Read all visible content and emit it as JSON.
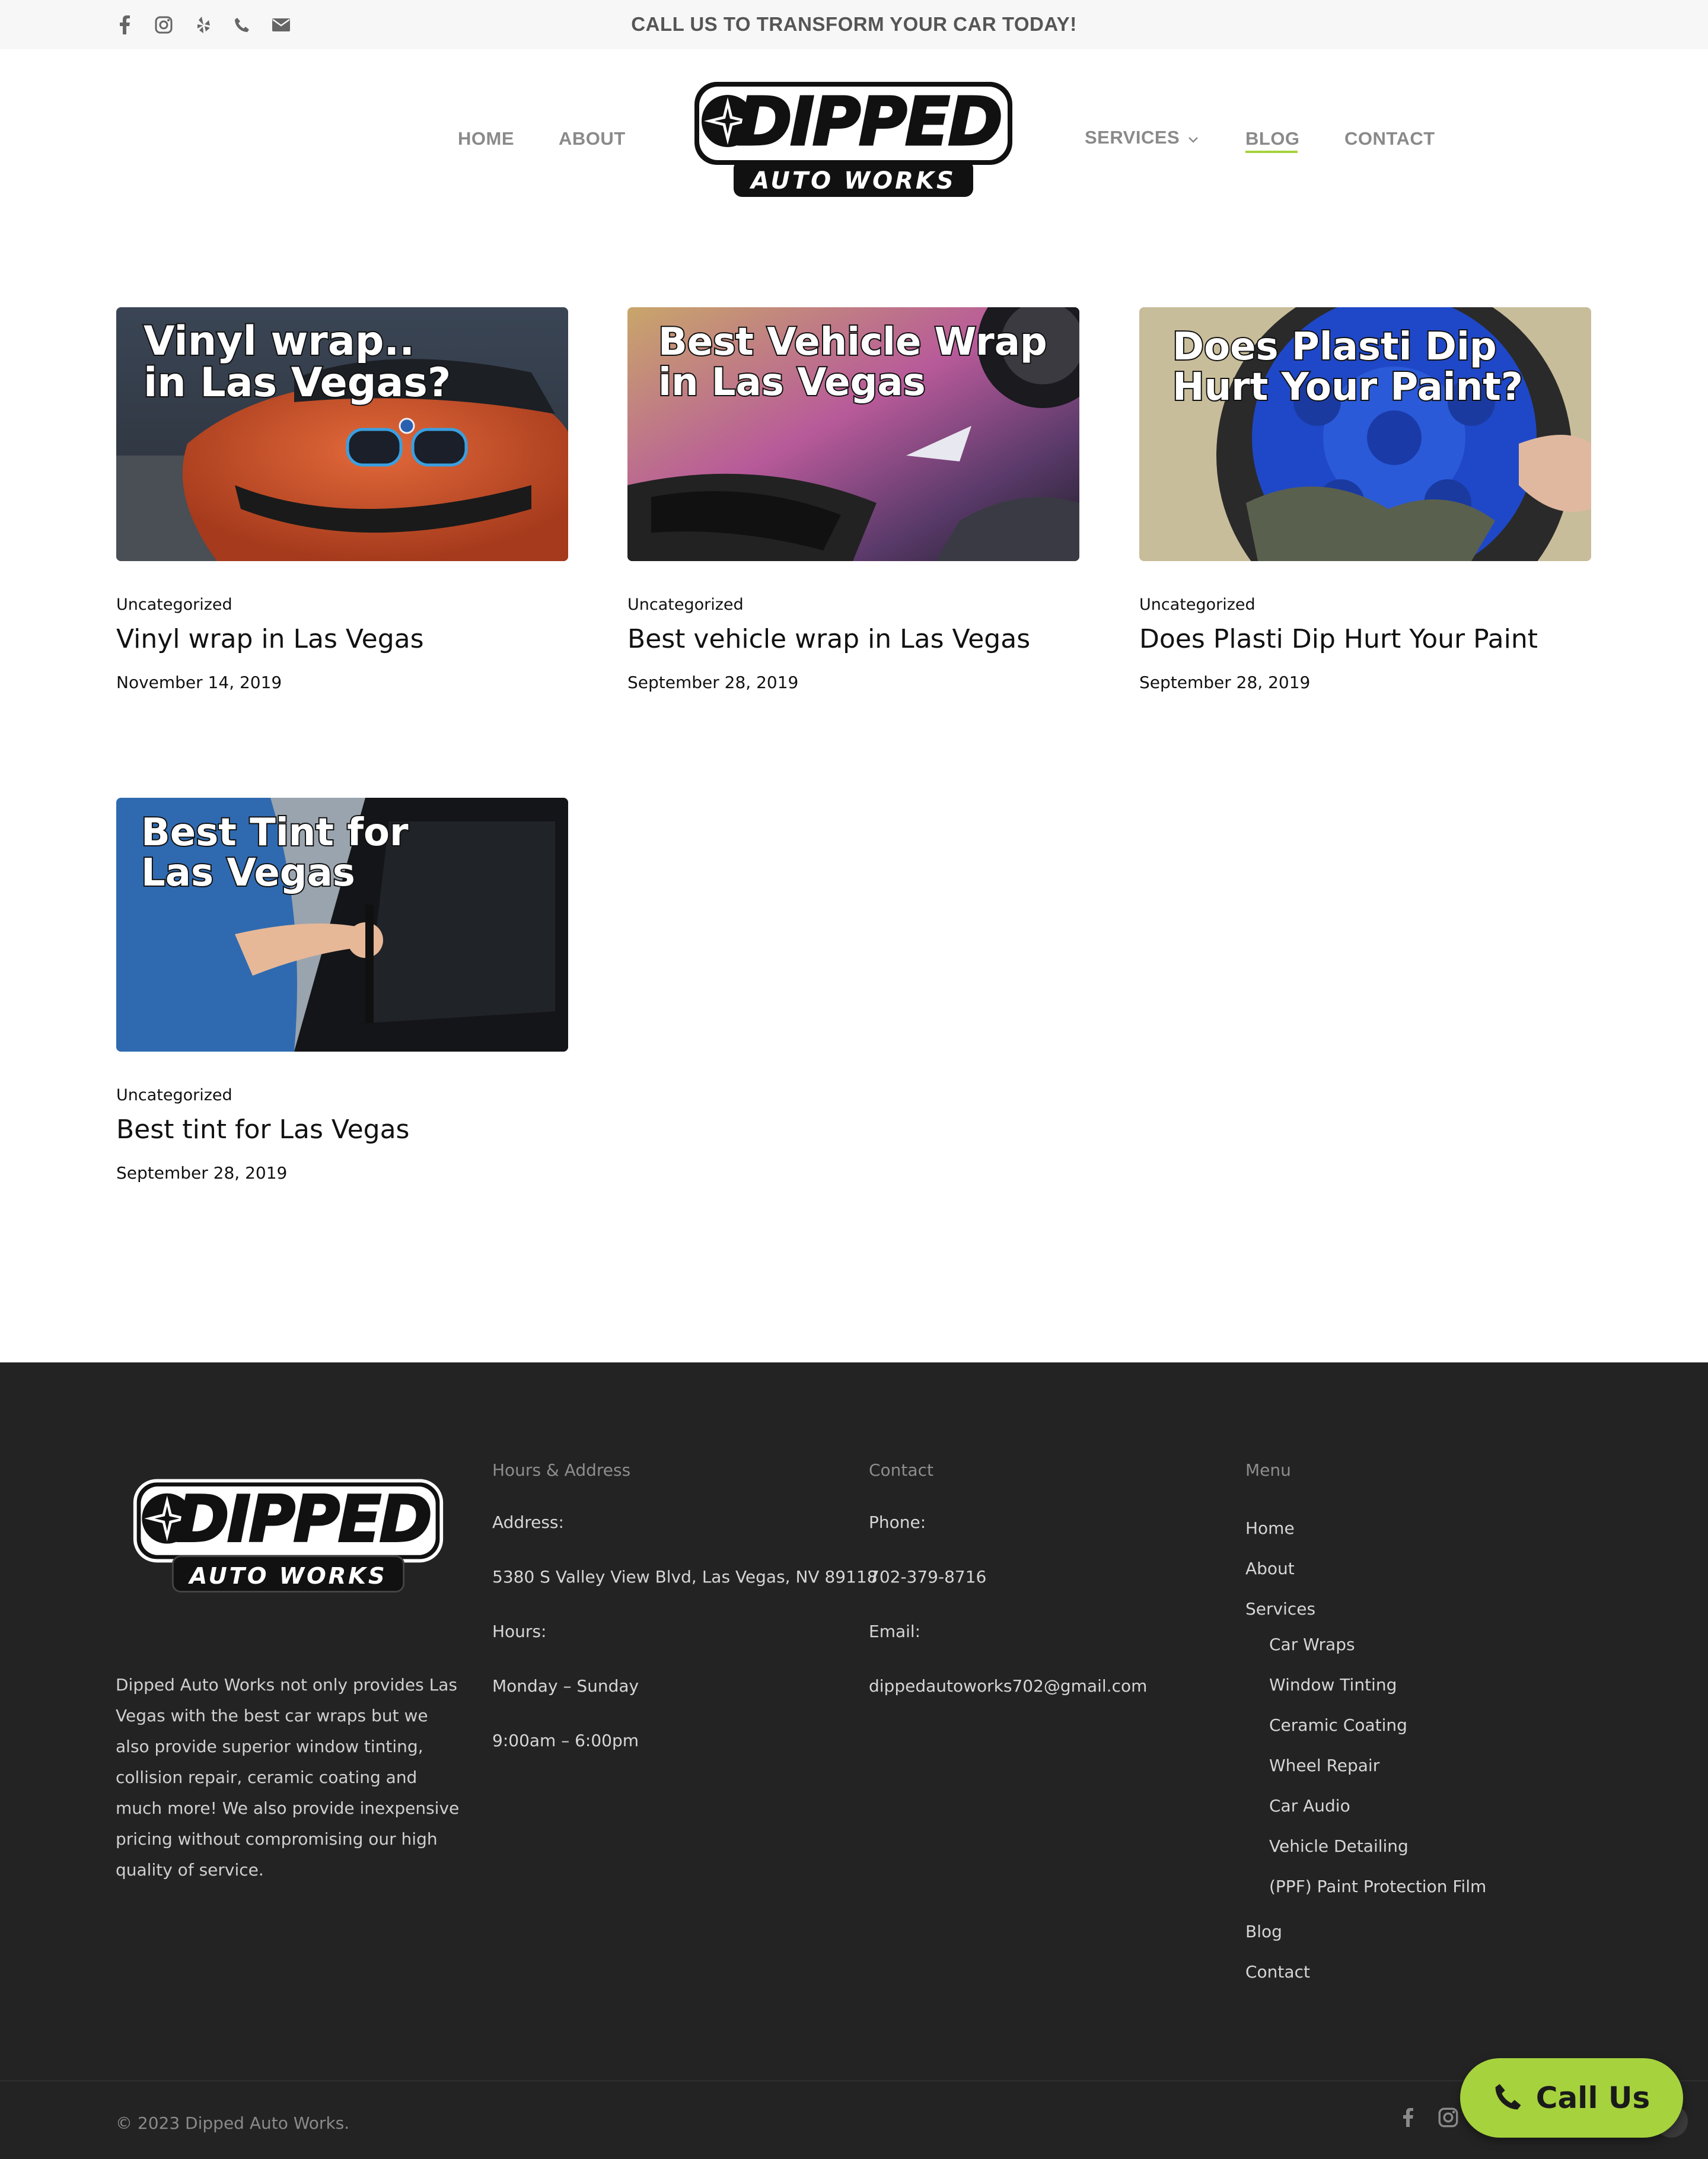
{
  "colors": {
    "accent": "#a6d23d",
    "footer_bg": "#232323",
    "topbar_bg": "#f7f7f7"
  },
  "topbar": {
    "tagline": "CALL US TO TRANSFORM YOUR CAR TODAY!",
    "social_icons": [
      "facebook-icon",
      "instagram-icon",
      "yelp-icon",
      "phone-icon",
      "email-icon"
    ]
  },
  "logo": {
    "main": "DIPPED",
    "sub": "AUTO WORKS"
  },
  "nav": {
    "home": "HOME",
    "about": "ABOUT",
    "services": "SERVICES",
    "blog": "BLOG",
    "contact": "CONTACT",
    "active": "BLOG"
  },
  "posts": [
    {
      "image_text_1": "Vinyl wrap..",
      "image_text_2": "in Las Vegas?",
      "category": "Uncategorized",
      "title": "Vinyl wrap in Las Vegas",
      "date": "November 14, 2019"
    },
    {
      "image_text_1": "Best Vehicle Wrap",
      "image_text_2": "in Las Vegas",
      "category": "Uncategorized",
      "title": "Best vehicle wrap in Las Vegas",
      "date": "September 28, 2019"
    },
    {
      "image_text_1": "Does Plasti Dip",
      "image_text_2": "Hurt Your Paint?",
      "category": "Uncategorized",
      "title": "Does Plasti Dip Hurt Your Paint",
      "date": "September 28, 2019"
    },
    {
      "image_text_1": "Best Tint for",
      "image_text_2": "Las Vegas",
      "category": "Uncategorized",
      "title": "Best tint for Las Vegas",
      "date": "September 28, 2019"
    }
  ],
  "footer": {
    "about": "Dipped Auto Works not only provides Las Vegas with the best car wraps but we also provide superior window tinting, collision repair, ceramic coating and much more! We also provide inexpensive pricing without compromising our high quality of service.",
    "hours": {
      "heading": "Hours & Address",
      "address_label": "Address:",
      "address": "5380 S Valley View Blvd, Las Vegas, NV 89118",
      "hours_label": "Hours:",
      "days": "Monday – Sunday",
      "time": "9:00am – 6:00pm"
    },
    "contact": {
      "heading": "Contact",
      "phone_label": "Phone:",
      "phone": "702-379-8716",
      "email_label": "Email:",
      "email": "dippedautoworks702@gmail.com"
    },
    "menu": {
      "heading": "Menu",
      "home": "Home",
      "about": "About",
      "services": "Services",
      "sub": [
        "Car Wraps",
        "Window Tinting",
        "Ceramic Coating",
        "Wheel Repair",
        "Car Audio",
        "Vehicle Detailing",
        "(PPF) Paint Protection Film"
      ],
      "blog": "Blog",
      "contact": "Contact"
    },
    "copyright": "© 2023 Dipped Auto Works.",
    "social_icons": [
      "facebook-icon",
      "instagram-icon"
    ]
  },
  "call_button": {
    "label": "Call Us",
    "icon": "phone-icon"
  }
}
